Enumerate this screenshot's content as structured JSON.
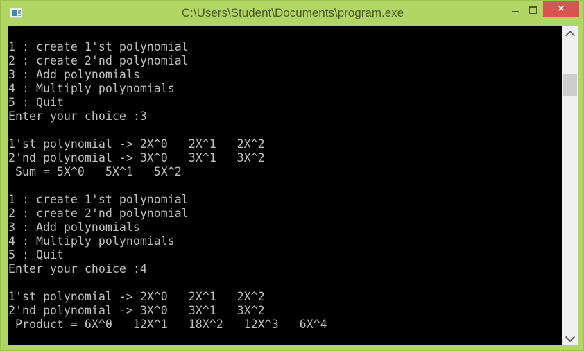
{
  "window": {
    "title": "C:\\Users\\Student\\Documents\\program.exe",
    "app_icon": "console-app-icon",
    "controls": {
      "minimize": "minimize-icon",
      "maximize": "maximize-icon",
      "close": "×"
    }
  },
  "console": {
    "lines": [
      "1 : create 1'st polynomial",
      "2 : create 2'nd polynomial",
      "3 : Add polynomials",
      "4 : Multiply polynomials",
      "5 : Quit",
      "Enter your choice :3",
      "",
      "1'st polynomial -> 2X^0   2X^1   2X^2",
      "2'nd polynomial -> 3X^0   3X^1   3X^2",
      " Sum = 5X^0   5X^1   5X^2",
      "",
      "1 : create 1'st polynomial",
      "2 : create 2'nd polynomial",
      "3 : Add polynomials",
      "4 : Multiply polynomials",
      "5 : Quit",
      "Enter your choice :4",
      "",
      "1'st polynomial -> 2X^0   2X^1   2X^2",
      "2'nd polynomial -> 3X^0   3X^1   3X^2",
      " Product = 6X^0   12X^1   18X^2   12X^3   6X^4"
    ],
    "text_color": "#c0c0c0",
    "background": "#000000"
  },
  "scrollbar": {
    "up": "chevron-up-icon",
    "down": "chevron-down-icon",
    "position": 0.15
  },
  "colors": {
    "frame": "#b1d665",
    "close": "#d9534f"
  }
}
